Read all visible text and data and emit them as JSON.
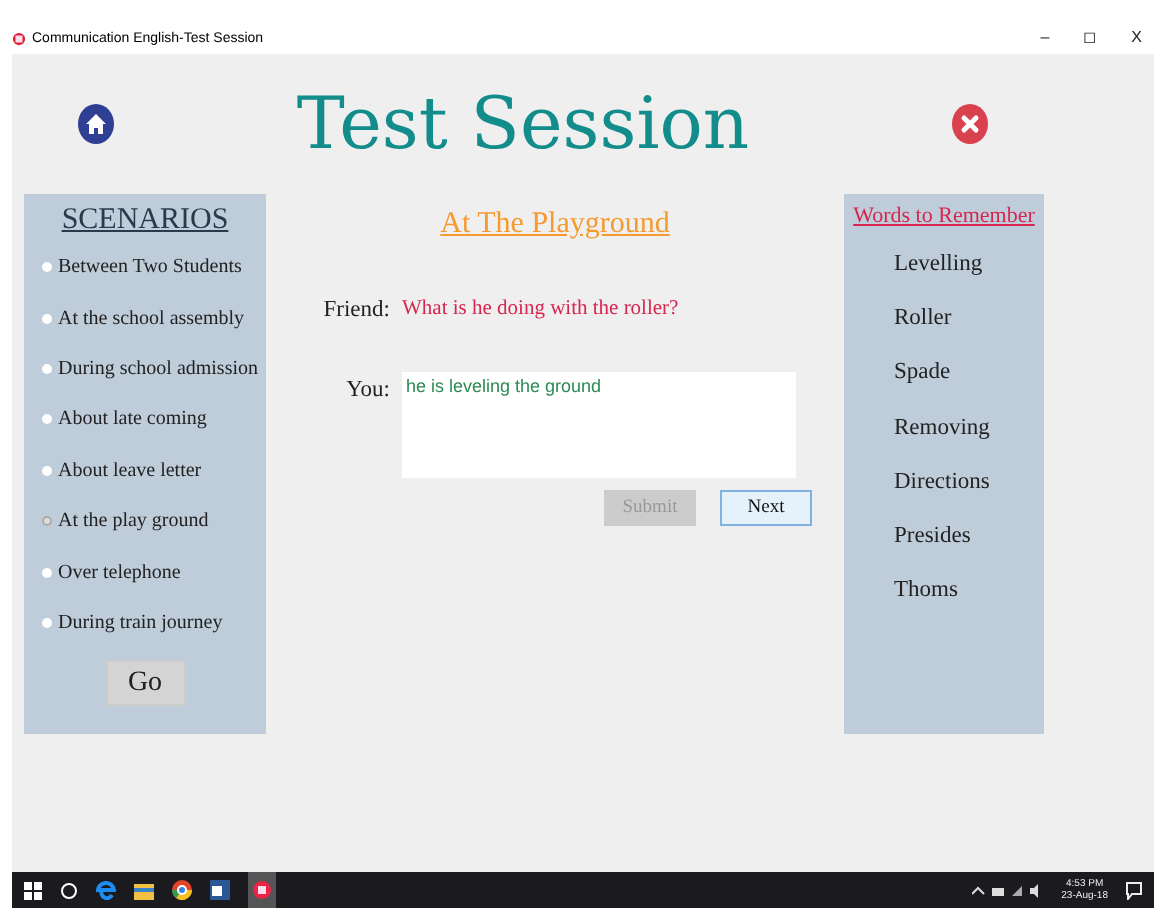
{
  "window": {
    "title": "Communication English-Test Session",
    "controls": [
      "–",
      "◻",
      "X"
    ]
  },
  "header": {
    "title": "Test Session"
  },
  "scenarios": {
    "heading": "SCENARIOS",
    "items": [
      {
        "label": "Between Two Students",
        "selected": false
      },
      {
        "label": "At the school assembly",
        "selected": false
      },
      {
        "label": "During school admission",
        "selected": false
      },
      {
        "label": "About late coming",
        "selected": false
      },
      {
        "label": "About leave letter",
        "selected": false
      },
      {
        "label": "At the play ground",
        "selected": true
      },
      {
        "label": "Over telephone",
        "selected": false
      },
      {
        "label": "During train journey",
        "selected": false
      }
    ],
    "button": "Go"
  },
  "session": {
    "title": "At The Playground",
    "friend_label": "Friend:",
    "friend_text": "What is he doing with the roller?",
    "you_label": "You:",
    "answer": "he is leveling the ground",
    "buttons": [
      {
        "label": "Submit",
        "disabled": true
      },
      {
        "label": "Next",
        "disabled": false
      }
    ]
  },
  "words": {
    "heading": "Words to Remember",
    "items": [
      "Levelling",
      "Roller",
      "Spade",
      "Removing",
      "Directions",
      "Presides",
      "Thoms"
    ]
  },
  "taskbar": {
    "time": "4:53 PM",
    "date": "23-Aug-18"
  }
}
